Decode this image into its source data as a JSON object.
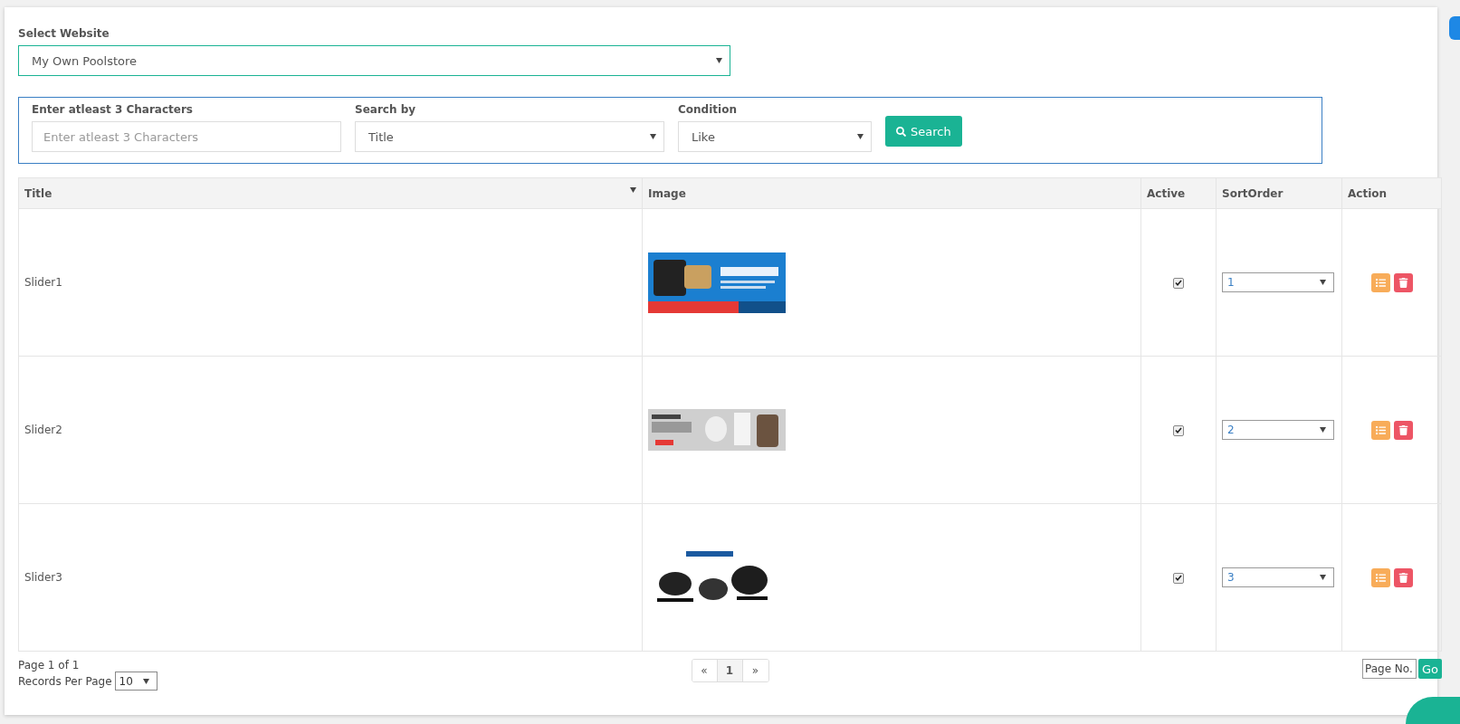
{
  "website_select": {
    "label": "Select Website",
    "value": "My Own Poolstore"
  },
  "search_panel": {
    "query": {
      "label": "Enter atleast 3 Characters",
      "placeholder": "Enter atleast 3 Characters"
    },
    "search_by": {
      "label": "Search by",
      "value": "Title"
    },
    "condition": {
      "label": "Condition",
      "value": "Like"
    },
    "button": "Search"
  },
  "table": {
    "columns": [
      {
        "label": "Title",
        "sortable": true
      },
      {
        "label": "Image",
        "sortable": false
      },
      {
        "label": "Active",
        "sortable": false
      },
      {
        "label": "SortOrder",
        "sortable": false
      },
      {
        "label": "Action",
        "sortable": false
      }
    ],
    "rows": [
      {
        "title": "Slider1",
        "active": true,
        "sort_order": "1"
      },
      {
        "title": "Slider2",
        "active": true,
        "sort_order": "2"
      },
      {
        "title": "Slider3",
        "active": true,
        "sort_order": "3"
      }
    ]
  },
  "footer": {
    "page_info": "Page 1 of 1",
    "records_label": "Records Per Page",
    "records_value": "10",
    "pager": [
      {
        "label": "«",
        "selected": false
      },
      {
        "label": "1",
        "selected": true
      },
      {
        "label": "»",
        "selected": false
      }
    ],
    "page_input_placeholder": "Page No.",
    "go": "Go"
  }
}
